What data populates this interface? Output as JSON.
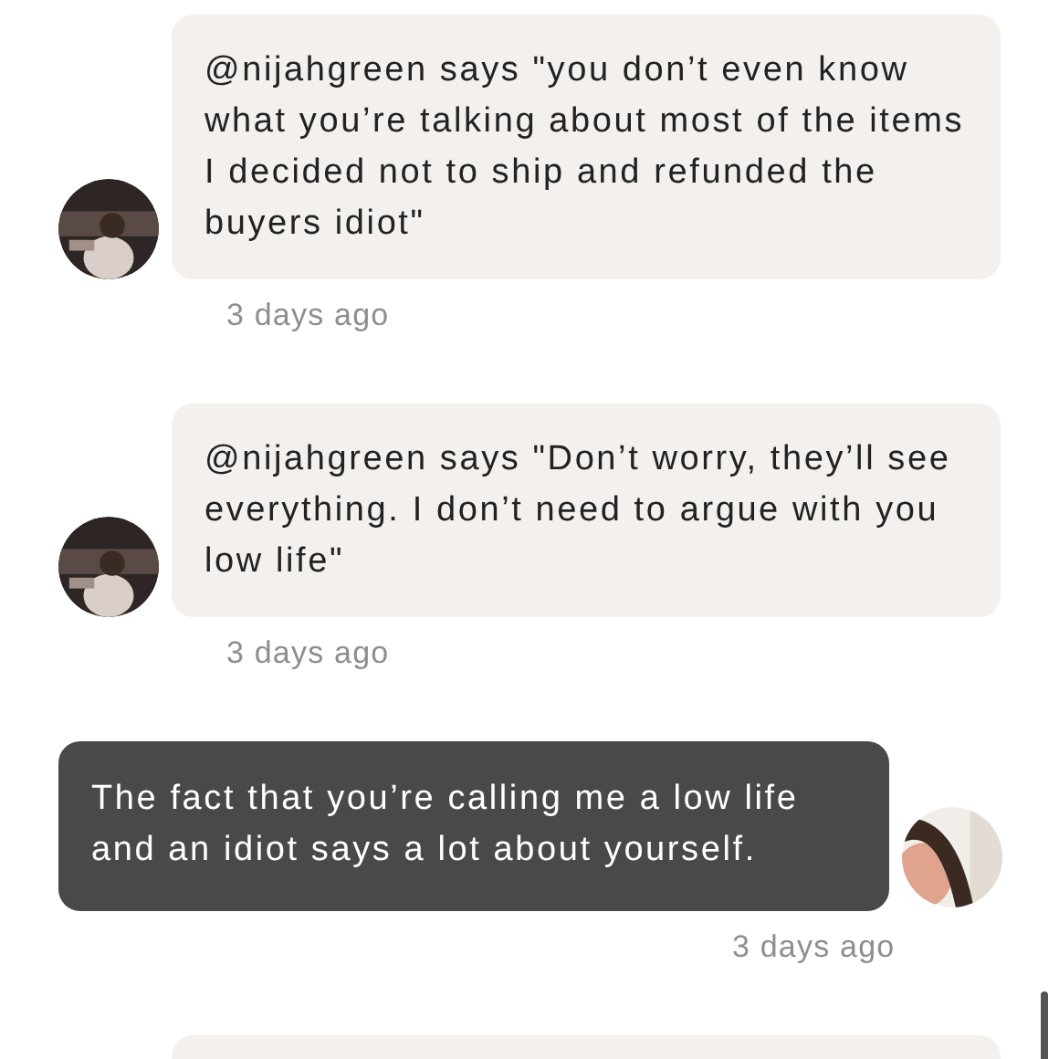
{
  "messages": [
    {
      "kind": "incoming",
      "text": "@nijahgreen says \"you don’t even know what you’re talking about most of the items I decided not to ship and refunded the buyers idiot\"",
      "time": "3 days ago"
    },
    {
      "kind": "incoming",
      "text": "@nijahgreen says \"Don’t worry, they’ll see everything. I don’t need to argue with you low life\"",
      "time": "3 days ago"
    },
    {
      "kind": "outgoing",
      "text": "The fact that you’re calling me a low life and an idiot says a lot about yourself.",
      "time": "3 days ago"
    },
    {
      "kind": "incoming"
    }
  ]
}
